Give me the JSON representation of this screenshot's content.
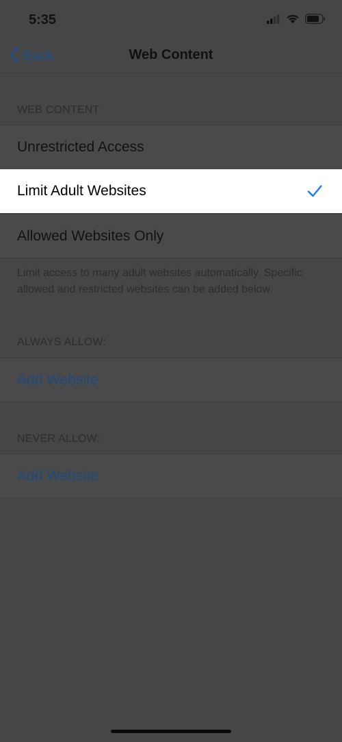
{
  "status_bar": {
    "time": "5:35",
    "icons": [
      "cellular-signal-icon",
      "wifi-icon",
      "battery-icon"
    ]
  },
  "nav": {
    "back_label": "Back",
    "title": "Web Content"
  },
  "web_content": {
    "header": "WEB CONTENT",
    "options": [
      {
        "label": "Unrestricted Access",
        "selected": false
      },
      {
        "label": "Limit Adult Websites",
        "selected": true
      },
      {
        "label": "Allowed Websites Only",
        "selected": false
      }
    ],
    "footer": "Limit access to many adult websites automatically. Specific allowed and restricted websites can be added below."
  },
  "always_allow": {
    "header": "ALWAYS ALLOW:",
    "add_label": "Add Website"
  },
  "never_allow": {
    "header": "NEVER ALLOW:",
    "add_label": "Add Website"
  },
  "colors": {
    "accent": "#1c7cf6",
    "dimmed_background": "#464646",
    "selected_row": "#ffffff"
  }
}
